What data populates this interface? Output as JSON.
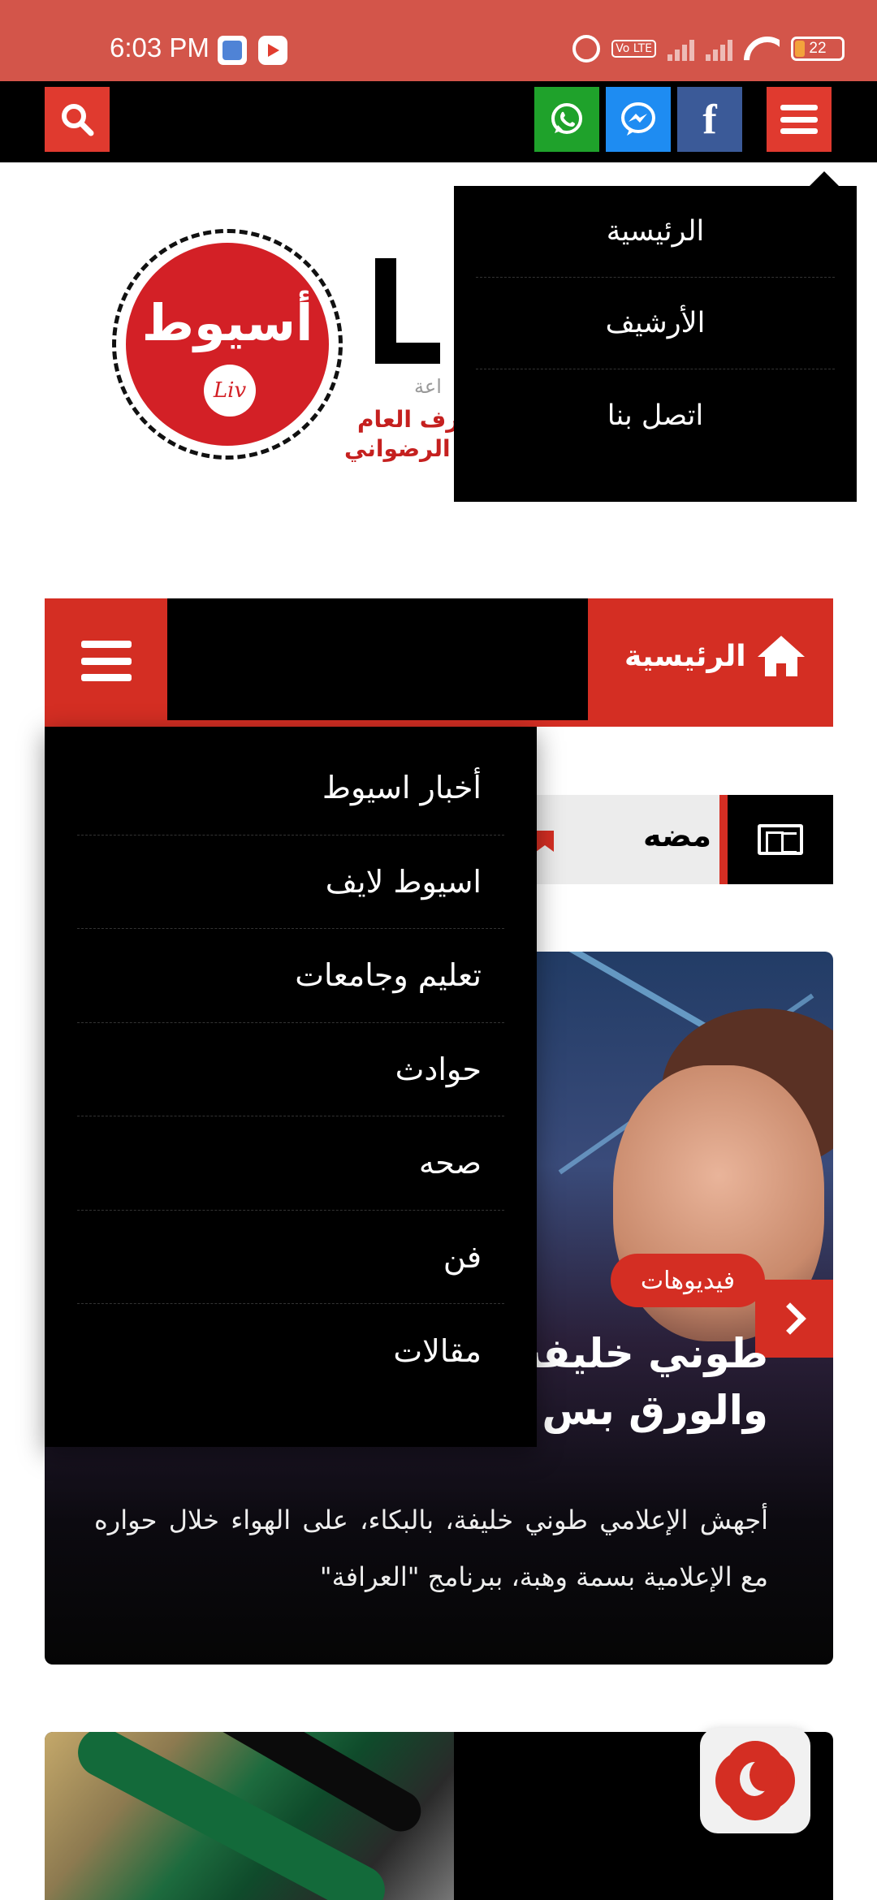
{
  "status_bar": {
    "time": "6:03 PM",
    "volte": "Vo LTE",
    "battery": "22"
  },
  "top_nav": {
    "icons": [
      "search-icon",
      "whatsapp-icon",
      "messenger-icon",
      "facebook-icon",
      "menu-icon"
    ],
    "facebook_glyph": "f"
  },
  "header_menu": {
    "items": [
      {
        "label": "الرئيسية"
      },
      {
        "label": "الأرشيف"
      },
      {
        "label": "اتصل بنا"
      }
    ]
  },
  "logo": {
    "text": "أسيوط",
    "badge": "Liv",
    "brand_sub": "اعة",
    "line1": "شرف العام",
    "line2": "د الرضواني"
  },
  "main_nav": {
    "home_label": "الرئيسية"
  },
  "breaking": {
    "text": "مضه"
  },
  "category_menu": {
    "items": [
      {
        "label": "أخبار اسيوط"
      },
      {
        "label": "اسيوط لايف"
      },
      {
        "label": "تعليم وجامعات"
      },
      {
        "label": "حوادث"
      },
      {
        "label": "صحه"
      },
      {
        "label": "فن"
      },
      {
        "label": "مقالات"
      }
    ]
  },
  "featured": {
    "category": "فيديوهات",
    "title": "طوني خليفة ي \"العرافة\": إحنا والورق بس",
    "excerpt": "أجهش الإعلامي طوني خليفة، بالبكاء، على الهواء خلال حواره مع الإعلامية بسمة وهبة، ببرنامج \"العرافة\""
  },
  "colors": {
    "accent": "#d42e23",
    "status_bar": "#d3554a",
    "whatsapp": "#1fa22b",
    "messenger": "#1e8cf2",
    "facebook": "#3b5a98"
  }
}
